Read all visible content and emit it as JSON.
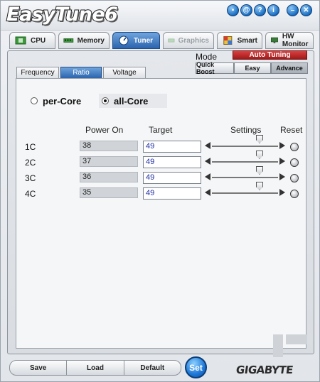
{
  "app": {
    "title": "EasyTune6"
  },
  "title_buttons": [
    {
      "name": "file-icon",
      "glyph": "▪"
    },
    {
      "name": "at-icon",
      "glyph": "@"
    },
    {
      "name": "help-icon",
      "glyph": "?"
    },
    {
      "name": "info-icon",
      "glyph": "i"
    },
    {
      "name": "minimize-icon",
      "glyph": "–"
    },
    {
      "name": "close-icon",
      "glyph": "✕"
    }
  ],
  "main_tabs": [
    {
      "label": "CPU",
      "icon": "cpu-chip-icon",
      "state": "normal"
    },
    {
      "label": "Memory",
      "icon": "memory-module-icon",
      "state": "normal"
    },
    {
      "label": "Tuner",
      "icon": "tuner-dial-icon",
      "state": "active"
    },
    {
      "label": "Graphics",
      "icon": "graphics-card-icon",
      "state": "disabled"
    },
    {
      "label": "Smart",
      "icon": "smart-cube-icon",
      "state": "normal"
    },
    {
      "label": "HW Monitor",
      "icon": "monitor-icon",
      "state": "normal"
    }
  ],
  "mode": {
    "label": "Mode",
    "badge": "Auto Tuning",
    "buttons": [
      "Quick Boost",
      "Easy",
      "Advance"
    ],
    "active": "Advance"
  },
  "sub_tabs": [
    {
      "label": "Frequency",
      "active": false
    },
    {
      "label": "Ratio",
      "active": true
    },
    {
      "label": "Voltage",
      "active": false
    }
  ],
  "core_mode": {
    "options": [
      "per-Core",
      "all-Core"
    ],
    "selected": "all-Core"
  },
  "table": {
    "headers": {
      "power_on": "Power On",
      "target": "Target",
      "settings": "Settings",
      "reset": "Reset"
    },
    "rows": [
      {
        "label": "1C",
        "power_on": "38",
        "target": "49",
        "slider_level": 0.72
      },
      {
        "label": "2C",
        "power_on": "37",
        "target": "49",
        "slider_level": 0.72
      },
      {
        "label": "3C",
        "power_on": "36",
        "target": "49",
        "slider_level": 0.72
      },
      {
        "label": "4C",
        "power_on": "35",
        "target": "49",
        "slider_level": 0.72
      }
    ]
  },
  "bottom_buttons": [
    "Save",
    "Load",
    "Default"
  ],
  "set_button": "Set",
  "brand": "GIGABYTE",
  "colors": {
    "accent": "#2b64ae",
    "badge": "#a11919"
  }
}
